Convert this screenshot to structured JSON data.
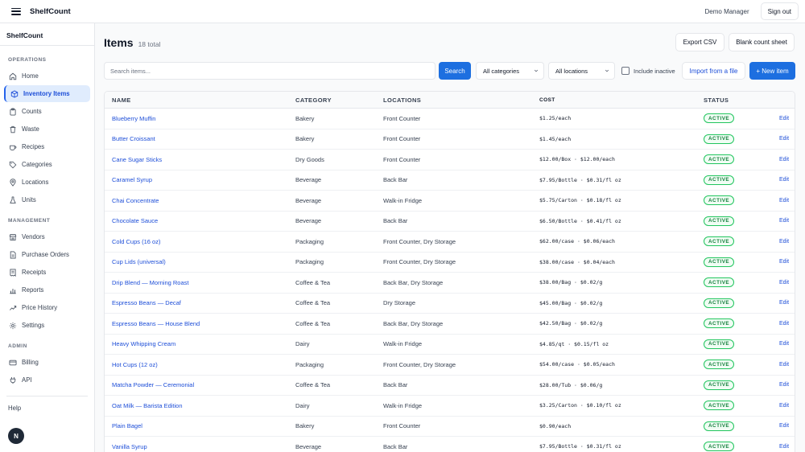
{
  "topbar": {
    "brand": "ShelfCount",
    "user": "Demo Manager",
    "signout": "Sign out"
  },
  "sidebar": {
    "brand": "ShelfCount",
    "sections": [
      {
        "label": "OPERATIONS",
        "items": [
          {
            "label": "Home",
            "icon": "home-icon"
          },
          {
            "label": "Inventory Items",
            "icon": "box-icon",
            "active": true
          },
          {
            "label": "Counts",
            "icon": "clipboard-icon"
          },
          {
            "label": "Waste",
            "icon": "trash-icon"
          },
          {
            "label": "Recipes",
            "icon": "cup-icon"
          },
          {
            "label": "Categories",
            "icon": "tag-icon"
          },
          {
            "label": "Locations",
            "icon": "map-pin-icon"
          },
          {
            "label": "Units",
            "icon": "flask-icon"
          }
        ]
      },
      {
        "label": "MANAGEMENT",
        "items": [
          {
            "label": "Vendors",
            "icon": "store-icon"
          },
          {
            "label": "Purchase Orders",
            "icon": "file-icon"
          },
          {
            "label": "Receipts",
            "icon": "receipt-icon"
          },
          {
            "label": "Reports",
            "icon": "chart-icon"
          },
          {
            "label": "Price History",
            "icon": "trend-icon"
          },
          {
            "label": "Settings",
            "icon": "gear-icon"
          }
        ]
      },
      {
        "label": "ADMIN",
        "items": [
          {
            "label": "Billing",
            "icon": "card-icon"
          },
          {
            "label": "API",
            "icon": "plug-icon"
          }
        ]
      }
    ],
    "help": "Help",
    "avatar": "N"
  },
  "header": {
    "title": "Items",
    "count": "18 total",
    "export": "Export CSV",
    "blank_sheet": "Blank count sheet"
  },
  "filters": {
    "search_placeholder": "Search items...",
    "search_button": "Search",
    "category": "All categories",
    "location": "All locations",
    "include_inactive": "Include inactive",
    "import": "Import from a file",
    "new_item": "+ New item"
  },
  "table": {
    "columns": [
      "NAME",
      "CATEGORY",
      "LOCATIONS",
      "COST",
      "STATUS"
    ],
    "edit_label": "Edit",
    "rows": [
      {
        "name": "Blueberry Muffin",
        "category": "Bakery",
        "locations": "Front Counter",
        "cost": "$1.25/each",
        "status": "ACTIVE"
      },
      {
        "name": "Butter Croissant",
        "category": "Bakery",
        "locations": "Front Counter",
        "cost": "$1.45/each",
        "status": "ACTIVE"
      },
      {
        "name": "Cane Sugar Sticks",
        "category": "Dry Goods",
        "locations": "Front Counter",
        "cost": "$12.00/Box · $12.00/each",
        "status": "ACTIVE"
      },
      {
        "name": "Caramel Syrup",
        "category": "Beverage",
        "locations": "Back Bar",
        "cost": "$7.95/Bottle · $0.31/fl oz",
        "status": "ACTIVE"
      },
      {
        "name": "Chai Concentrate",
        "category": "Beverage",
        "locations": "Walk-in Fridge",
        "cost": "$5.75/Carton · $0.18/fl oz",
        "status": "ACTIVE"
      },
      {
        "name": "Chocolate Sauce",
        "category": "Beverage",
        "locations": "Back Bar",
        "cost": "$6.50/Bottle · $0.41/fl oz",
        "status": "ACTIVE"
      },
      {
        "name": "Cold Cups (16 oz)",
        "category": "Packaging",
        "locations": "Front Counter, Dry Storage",
        "cost": "$62.00/case · $0.06/each",
        "status": "ACTIVE"
      },
      {
        "name": "Cup Lids (universal)",
        "category": "Packaging",
        "locations": "Front Counter, Dry Storage",
        "cost": "$38.00/case · $0.04/each",
        "status": "ACTIVE"
      },
      {
        "name": "Drip Blend — Morning Roast",
        "category": "Coffee & Tea",
        "locations": "Back Bar, Dry Storage",
        "cost": "$38.00/Bag · $0.02/g",
        "status": "ACTIVE"
      },
      {
        "name": "Espresso Beans — Decaf",
        "category": "Coffee & Tea",
        "locations": "Dry Storage",
        "cost": "$45.00/Bag · $0.02/g",
        "status": "ACTIVE"
      },
      {
        "name": "Espresso Beans — House Blend",
        "category": "Coffee & Tea",
        "locations": "Back Bar, Dry Storage",
        "cost": "$42.50/Bag · $0.02/g",
        "status": "ACTIVE"
      },
      {
        "name": "Heavy Whipping Cream",
        "category": "Dairy",
        "locations": "Walk-in Fridge",
        "cost": "$4.85/qt · $0.15/fl oz",
        "status": "ACTIVE"
      },
      {
        "name": "Hot Cups (12 oz)",
        "category": "Packaging",
        "locations": "Front Counter, Dry Storage",
        "cost": "$54.00/case · $0.05/each",
        "status": "ACTIVE"
      },
      {
        "name": "Matcha Powder — Ceremonial",
        "category": "Coffee & Tea",
        "locations": "Back Bar",
        "cost": "$28.00/Tub · $0.06/g",
        "status": "ACTIVE"
      },
      {
        "name": "Oat Milk — Barista Edition",
        "category": "Dairy",
        "locations": "Walk-in Fridge",
        "cost": "$3.25/Carton · $0.10/fl oz",
        "status": "ACTIVE"
      },
      {
        "name": "Plain Bagel",
        "category": "Bakery",
        "locations": "Front Counter",
        "cost": "$0.90/each",
        "status": "ACTIVE"
      },
      {
        "name": "Vanilla Syrup",
        "category": "Beverage",
        "locations": "Back Bar",
        "cost": "$7.95/Bottle · $0.31/fl oz",
        "status": "ACTIVE"
      }
    ]
  }
}
